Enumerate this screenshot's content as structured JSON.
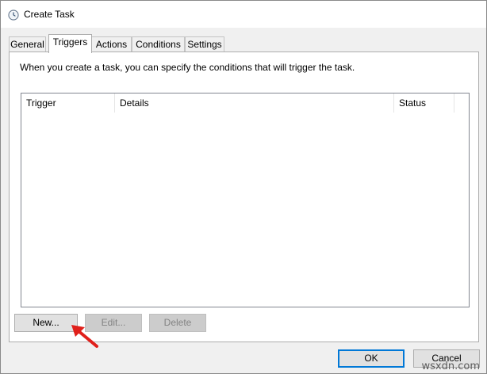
{
  "window": {
    "title": "Create Task",
    "title_icon": "task-scheduler-clock-icon"
  },
  "tabs": [
    {
      "label": "General",
      "active": false
    },
    {
      "label": "Triggers",
      "active": true
    },
    {
      "label": "Actions",
      "active": false
    },
    {
      "label": "Conditions",
      "active": false
    },
    {
      "label": "Settings",
      "active": false
    }
  ],
  "triggers_panel": {
    "description": "When you create a task, you can specify the conditions that will trigger the task.",
    "columns": [
      "Trigger",
      "Details",
      "Status"
    ],
    "rows": []
  },
  "buttons": {
    "new": "New...",
    "edit": "Edit...",
    "delete": "Delete",
    "ok": "OK",
    "cancel": "Cancel"
  },
  "annotation": {
    "arrow_icon": "red-arrow-icon",
    "arrow_color": "#e0201b"
  },
  "colors": {
    "accent": "#0078d7"
  },
  "watermark": "wsxdn.com"
}
